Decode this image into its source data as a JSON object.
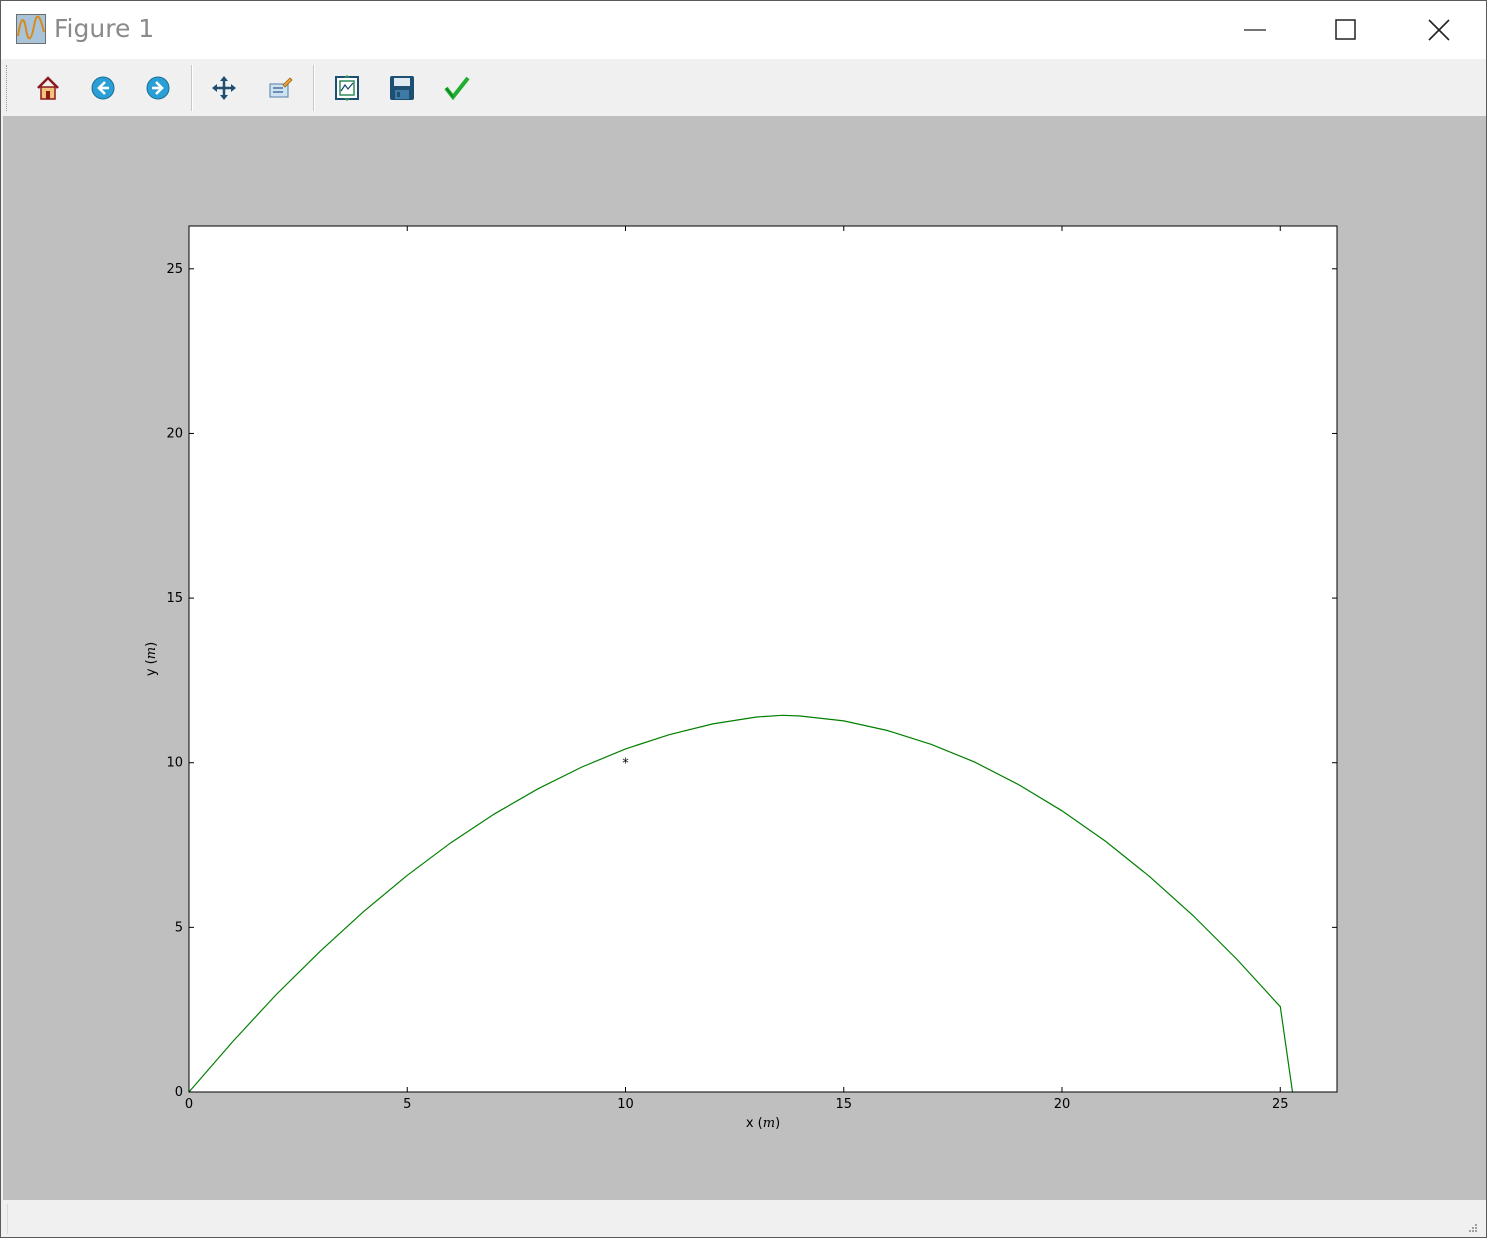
{
  "window": {
    "title": "Figure 1",
    "icon": "matplotlib-figure-icon",
    "controls": {
      "minimize": "minimize-icon",
      "maximize": "maximize-icon",
      "close": "close-icon"
    }
  },
  "toolbar": {
    "items": [
      {
        "name": "home-button",
        "icon": "home-icon"
      },
      {
        "name": "back-button",
        "icon": "back-arrow-icon"
      },
      {
        "name": "forward-button",
        "icon": "forward-arrow-icon"
      },
      {
        "name": "pan-button",
        "icon": "move-icon"
      },
      {
        "name": "zoom-button",
        "icon": "zoom-rect-icon"
      },
      {
        "name": "subplots-button",
        "icon": "subplots-icon"
      },
      {
        "name": "save-button",
        "icon": "floppy-disk-icon"
      },
      {
        "name": "edit-parameters-button",
        "icon": "checkmark-icon"
      }
    ]
  },
  "chart_data": {
    "type": "line",
    "title": "",
    "xlabel": "x ($m$)",
    "ylabel": "y ($m$)",
    "xlabel_display": {
      "prefix": "x (",
      "var": "m",
      "suffix": ")"
    },
    "ylabel_display": {
      "prefix": "y (",
      "var": "m",
      "suffix": ")"
    },
    "xlim": [
      0,
      26.3
    ],
    "ylim": [
      0,
      26.3
    ],
    "xticks": [
      0,
      5,
      10,
      15,
      20,
      25
    ],
    "yticks": [
      0,
      5,
      10,
      15,
      20,
      25
    ],
    "grid": false,
    "series": [
      {
        "color": "#008000",
        "marker": "none",
        "x": [
          0,
          1,
          2,
          3,
          4,
          5,
          6,
          7,
          8,
          9,
          10,
          11,
          12,
          13,
          13.6,
          14,
          15,
          16,
          17,
          18,
          19,
          20,
          21,
          22,
          23,
          24,
          25,
          25.28
        ],
        "y": [
          0,
          1.53,
          2.96,
          4.27,
          5.48,
          6.58,
          7.57,
          8.45,
          9.21,
          9.87,
          10.42,
          10.85,
          11.18,
          11.39,
          11.44,
          11.42,
          11.27,
          10.98,
          10.56,
          10.02,
          9.34,
          8.54,
          7.61,
          6.55,
          5.36,
          4.04,
          2.59,
          0
        ]
      },
      {
        "color": "#000000",
        "marker": "*",
        "x": [
          10
        ],
        "y": [
          10
        ]
      }
    ]
  }
}
